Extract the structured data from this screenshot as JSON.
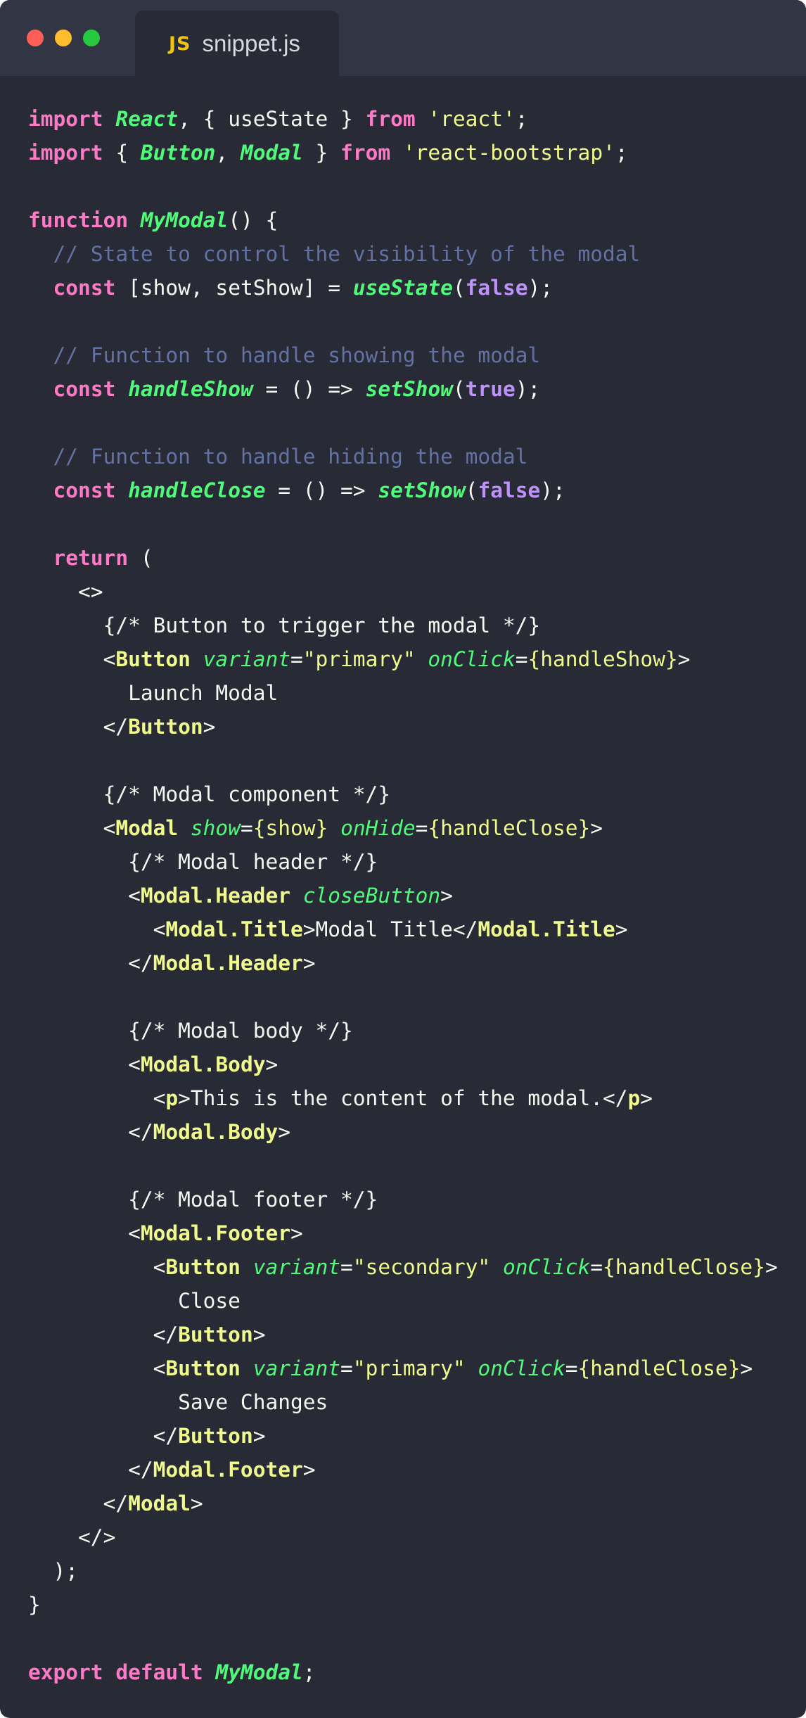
{
  "window": {
    "controls": {
      "close_color": "#ff5f56",
      "minimize_color": "#ffbd2e",
      "maximize_color": "#27c93f"
    },
    "tab": {
      "icon_label": "JS",
      "icon_color": "#f1c40f",
      "filename": "snippet.js"
    }
  },
  "theme": {
    "background": "#282a36",
    "titlebar": "#323543"
  },
  "code": {
    "language": "javascript",
    "lines": [
      [
        [
          "keyword",
          "import"
        ],
        [
          "plain",
          " "
        ],
        [
          "class",
          "React"
        ],
        [
          "plain",
          ", { useState } "
        ],
        [
          "keyword",
          "from"
        ],
        [
          "plain",
          " "
        ],
        [
          "string",
          "'react'"
        ],
        [
          "plain",
          ";"
        ]
      ],
      [
        [
          "keyword",
          "import"
        ],
        [
          "plain",
          " { "
        ],
        [
          "class",
          "Button"
        ],
        [
          "plain",
          ", "
        ],
        [
          "class",
          "Modal"
        ],
        [
          "plain",
          " } "
        ],
        [
          "keyword",
          "from"
        ],
        [
          "plain",
          " "
        ],
        [
          "string",
          "'react-bootstrap'"
        ],
        [
          "plain",
          ";"
        ]
      ],
      [],
      [
        [
          "keyword",
          "function"
        ],
        [
          "plain",
          " "
        ],
        [
          "func",
          "MyModal"
        ],
        [
          "plain",
          "() {"
        ]
      ],
      [
        [
          "plain",
          "  "
        ],
        [
          "comment",
          "// State to control the visibility of the modal"
        ]
      ],
      [
        [
          "plain",
          "  "
        ],
        [
          "keyword",
          "const"
        ],
        [
          "plain",
          " [show, setShow] = "
        ],
        [
          "func",
          "useState"
        ],
        [
          "plain",
          "("
        ],
        [
          "bool",
          "false"
        ],
        [
          "plain",
          ");"
        ]
      ],
      [],
      [
        [
          "plain",
          "  "
        ],
        [
          "comment",
          "// Function to handle showing the modal"
        ]
      ],
      [
        [
          "plain",
          "  "
        ],
        [
          "keyword",
          "const"
        ],
        [
          "plain",
          " "
        ],
        [
          "func",
          "handleShow"
        ],
        [
          "plain",
          " = () => "
        ],
        [
          "func",
          "setShow"
        ],
        [
          "plain",
          "("
        ],
        [
          "bool",
          "true"
        ],
        [
          "plain",
          ");"
        ]
      ],
      [],
      [
        [
          "plain",
          "  "
        ],
        [
          "comment",
          "// Function to handle hiding the modal"
        ]
      ],
      [
        [
          "plain",
          "  "
        ],
        [
          "keyword",
          "const"
        ],
        [
          "plain",
          " "
        ],
        [
          "func",
          "handleClose"
        ],
        [
          "plain",
          " = () => "
        ],
        [
          "func",
          "setShow"
        ],
        [
          "plain",
          "("
        ],
        [
          "bool",
          "false"
        ],
        [
          "plain",
          ");"
        ]
      ],
      [],
      [
        [
          "plain",
          "  "
        ],
        [
          "keyword",
          "return"
        ],
        [
          "plain",
          " ("
        ]
      ],
      [
        [
          "plain",
          "    <>"
        ]
      ],
      [
        [
          "plain",
          "      {/* Button to trigger the modal */}"
        ]
      ],
      [
        [
          "plain",
          "      <"
        ],
        [
          "tag",
          "Button"
        ],
        [
          "plain",
          " "
        ],
        [
          "attr",
          "variant"
        ],
        [
          "plain",
          "="
        ],
        [
          "jsx",
          "\"primary\""
        ],
        [
          "plain",
          " "
        ],
        [
          "attr",
          "onClick"
        ],
        [
          "plain",
          "="
        ],
        [
          "jsx",
          "{handleShow}"
        ],
        [
          "plain",
          ">"
        ]
      ],
      [
        [
          "plain",
          "        Launch Modal"
        ]
      ],
      [
        [
          "plain",
          "      </"
        ],
        [
          "tag",
          "Button"
        ],
        [
          "plain",
          ">"
        ]
      ],
      [],
      [
        [
          "plain",
          "      {/* Modal component */}"
        ]
      ],
      [
        [
          "plain",
          "      <"
        ],
        [
          "tag",
          "Modal"
        ],
        [
          "plain",
          " "
        ],
        [
          "attr",
          "show"
        ],
        [
          "plain",
          "="
        ],
        [
          "jsx",
          "{show}"
        ],
        [
          "plain",
          " "
        ],
        [
          "attr",
          "onHide"
        ],
        [
          "plain",
          "="
        ],
        [
          "jsx",
          "{handleClose}"
        ],
        [
          "plain",
          ">"
        ]
      ],
      [
        [
          "plain",
          "        {/* Modal header */}"
        ]
      ],
      [
        [
          "plain",
          "        <"
        ],
        [
          "tag",
          "Modal.Header"
        ],
        [
          "plain",
          " "
        ],
        [
          "attr",
          "closeButton"
        ],
        [
          "plain",
          ">"
        ]
      ],
      [
        [
          "plain",
          "          <"
        ],
        [
          "tag",
          "Modal.Title"
        ],
        [
          "plain",
          ">Modal Title</"
        ],
        [
          "tag",
          "Modal.Title"
        ],
        [
          "plain",
          ">"
        ]
      ],
      [
        [
          "plain",
          "        </"
        ],
        [
          "tag",
          "Modal.Header"
        ],
        [
          "plain",
          ">"
        ]
      ],
      [],
      [
        [
          "plain",
          "        {/* Modal body */}"
        ]
      ],
      [
        [
          "plain",
          "        <"
        ],
        [
          "tag",
          "Modal.Body"
        ],
        [
          "plain",
          ">"
        ]
      ],
      [
        [
          "plain",
          "          <"
        ],
        [
          "tag",
          "p"
        ],
        [
          "plain",
          ">This is the content of the modal.</"
        ],
        [
          "tag",
          "p"
        ],
        [
          "plain",
          ">"
        ]
      ],
      [
        [
          "plain",
          "        </"
        ],
        [
          "tag",
          "Modal.Body"
        ],
        [
          "plain",
          ">"
        ]
      ],
      [],
      [
        [
          "plain",
          "        {/* Modal footer */}"
        ]
      ],
      [
        [
          "plain",
          "        <"
        ],
        [
          "tag",
          "Modal.Footer"
        ],
        [
          "plain",
          ">"
        ]
      ],
      [
        [
          "plain",
          "          <"
        ],
        [
          "tag",
          "Button"
        ],
        [
          "plain",
          " "
        ],
        [
          "attr",
          "variant"
        ],
        [
          "plain",
          "="
        ],
        [
          "jsx",
          "\"secondary\""
        ],
        [
          "plain",
          " "
        ],
        [
          "attr",
          "onClick"
        ],
        [
          "plain",
          "="
        ],
        [
          "jsx",
          "{handleClose}"
        ],
        [
          "plain",
          ">"
        ]
      ],
      [
        [
          "plain",
          "            Close"
        ]
      ],
      [
        [
          "plain",
          "          </"
        ],
        [
          "tag",
          "Button"
        ],
        [
          "plain",
          ">"
        ]
      ],
      [
        [
          "plain",
          "          <"
        ],
        [
          "tag",
          "Button"
        ],
        [
          "plain",
          " "
        ],
        [
          "attr",
          "variant"
        ],
        [
          "plain",
          "="
        ],
        [
          "jsx",
          "\"primary\""
        ],
        [
          "plain",
          " "
        ],
        [
          "attr",
          "onClick"
        ],
        [
          "plain",
          "="
        ],
        [
          "jsx",
          "{handleClose}"
        ],
        [
          "plain",
          ">"
        ]
      ],
      [
        [
          "plain",
          "            Save Changes"
        ]
      ],
      [
        [
          "plain",
          "          </"
        ],
        [
          "tag",
          "Button"
        ],
        [
          "plain",
          ">"
        ]
      ],
      [
        [
          "plain",
          "        </"
        ],
        [
          "tag",
          "Modal.Footer"
        ],
        [
          "plain",
          ">"
        ]
      ],
      [
        [
          "plain",
          "      </"
        ],
        [
          "tag",
          "Modal"
        ],
        [
          "plain",
          ">"
        ]
      ],
      [
        [
          "plain",
          "    </>"
        ]
      ],
      [
        [
          "plain",
          "  );"
        ]
      ],
      [
        [
          "plain",
          "}"
        ]
      ],
      [],
      [
        [
          "keyword",
          "export"
        ],
        [
          "plain",
          " "
        ],
        [
          "keyword",
          "default"
        ],
        [
          "plain",
          " "
        ],
        [
          "func",
          "MyModal"
        ],
        [
          "plain",
          ";"
        ]
      ]
    ]
  }
}
